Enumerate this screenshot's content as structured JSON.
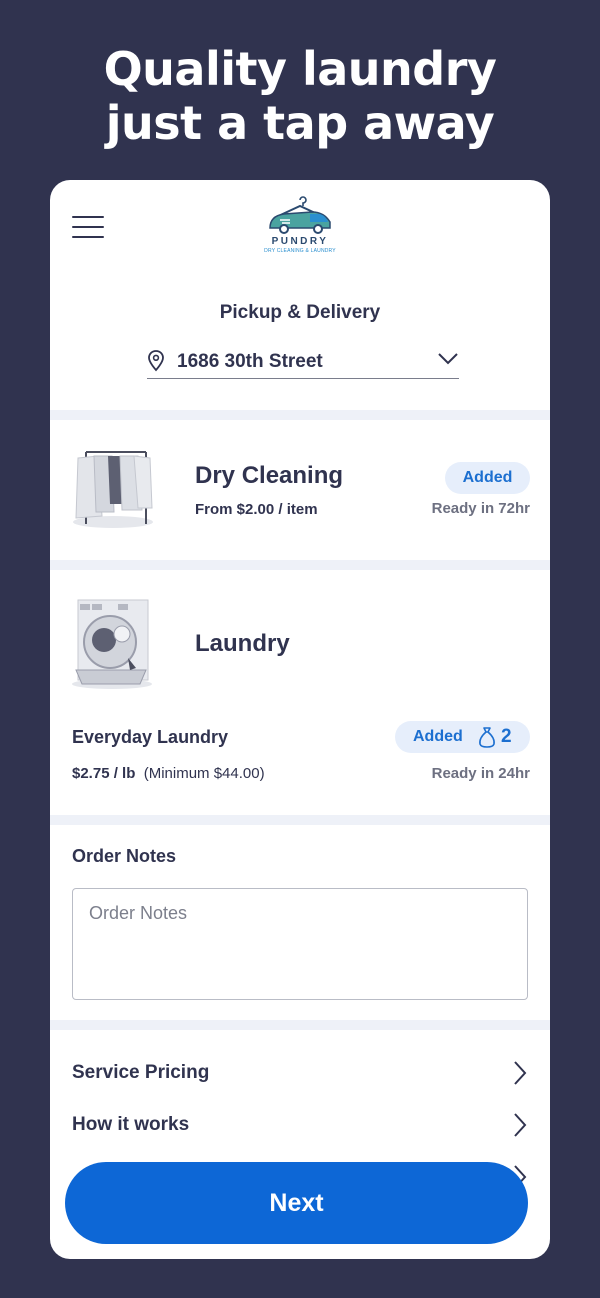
{
  "headline": {
    "line1": "Quality laundry",
    "line2": "just a tap away"
  },
  "header": {
    "brand_name": "PUNDRY",
    "brand_tagline": "DRY CLEANING & LAUNDRY"
  },
  "delivery": {
    "title": "Pickup & Delivery",
    "address": "1686 30th Street"
  },
  "services": [
    {
      "title": "Dry Cleaning",
      "subtitle": "From $2.00 / item",
      "badge": "Added",
      "ready": "Ready in 72hr"
    },
    {
      "title": "Laundry",
      "item_name": "Everyday Laundry",
      "price": "$2.75 / lb",
      "minimum": "(Minimum $44.00)",
      "badge": "Added",
      "bag_count": "2",
      "ready": "Ready in 24hr"
    }
  ],
  "notes": {
    "title": "Order Notes",
    "placeholder": "Order Notes"
  },
  "links": [
    {
      "label": "Service Pricing"
    },
    {
      "label": "How it works"
    }
  ],
  "cta": {
    "label": "Next"
  },
  "colors": {
    "background": "#30334f",
    "accent": "#0d67d6",
    "badge_bg": "#e6eefb",
    "badge_text": "#1c6fd0"
  }
}
